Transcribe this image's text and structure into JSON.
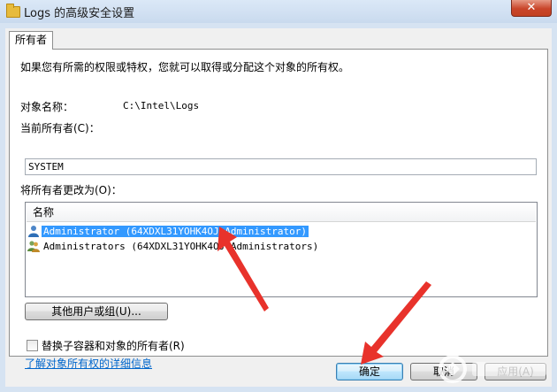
{
  "window": {
    "title": "Logs 的高级安全设置",
    "close_label": "✕"
  },
  "tabs": [
    {
      "label": "所有者"
    }
  ],
  "intro": "如果您有所需的权限或特权，您就可以取得或分配这个对象的所有权。",
  "object": {
    "label": "对象名称：",
    "value": "C:\\Intel\\Logs"
  },
  "current_owner": {
    "label": "当前所有者(C)：",
    "value": "SYSTEM"
  },
  "change_owner": {
    "label": "将所有者更改为(O)：",
    "column_header": "名称",
    "items": [
      {
        "name": "Administrator (64XDXL31YOHK4OJ\\Administrator)",
        "selected": true,
        "icon": "user-icon"
      },
      {
        "name": "Administrators (64XDXL31YOHK4OJ\\Administrators)",
        "selected": false,
        "icon": "users-group-icon"
      }
    ]
  },
  "buttons": {
    "other_users": "其他用户或组(U)...",
    "ok": "确定",
    "cancel": "取消",
    "apply": "应用(A)"
  },
  "replace_checkbox": {
    "label": "替换子容器和对象的所有者(R)",
    "checked": false
  },
  "help_link": "了解对象所有权的详细信息",
  "colors": {
    "selection": "#3399ff",
    "annotation_arrow": "#e8322b",
    "link": "#0066cc"
  }
}
